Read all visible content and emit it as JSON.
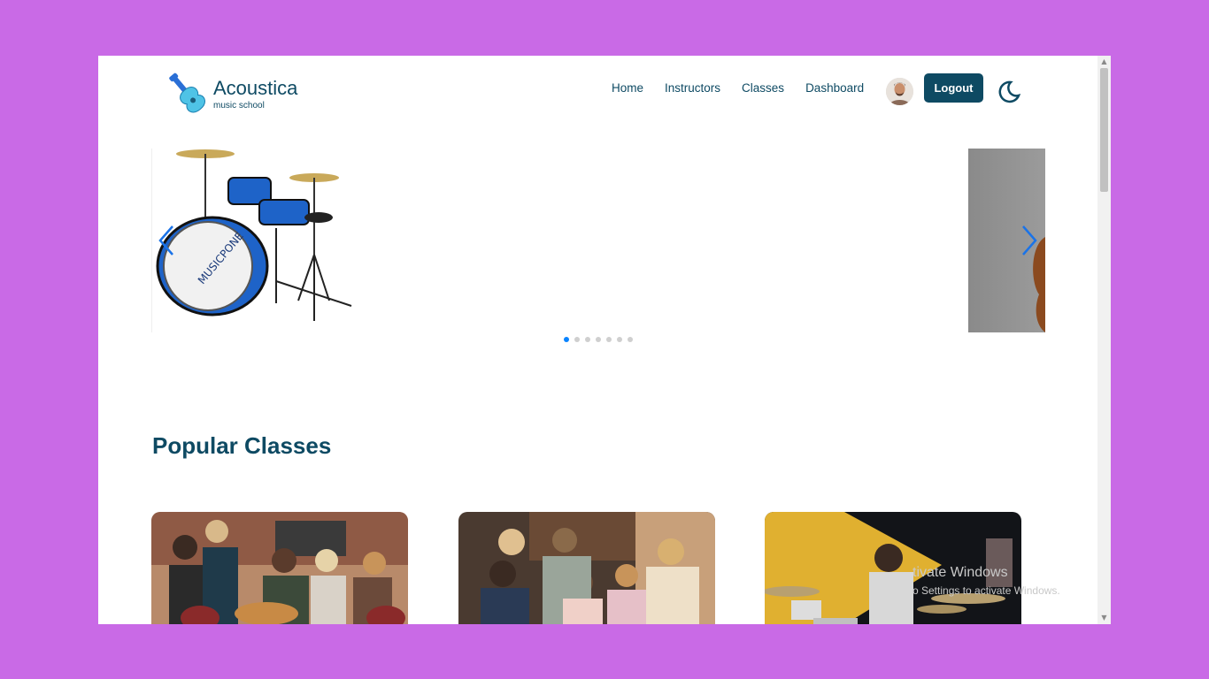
{
  "brand": {
    "name": "Acoustica",
    "tagline": "music school",
    "icon": "guitar-icon"
  },
  "nav": {
    "items": [
      "Home",
      "Instructors",
      "Classes",
      "Dashboard"
    ],
    "logout_label": "Logout",
    "avatar": "user-avatar",
    "theme_toggle_icon": "moon-icon"
  },
  "carousel": {
    "slides": [
      "drum-kit-image",
      "guitar-image"
    ],
    "dot_count": 7,
    "active_dot": 0
  },
  "sections": {
    "popular_title": "Popular Classes"
  },
  "classes": [
    {
      "image": "group-guitar-photo"
    },
    {
      "image": "kids-singing-photo"
    },
    {
      "image": "drummer-photo"
    }
  ],
  "overlay": {
    "watermark_title": "tivate Windows",
    "watermark_sub": "o Settings to activate Windows."
  },
  "colors": {
    "primary": "#0e4a63",
    "background": "#c96ae6",
    "accent": "#0a84ff"
  }
}
